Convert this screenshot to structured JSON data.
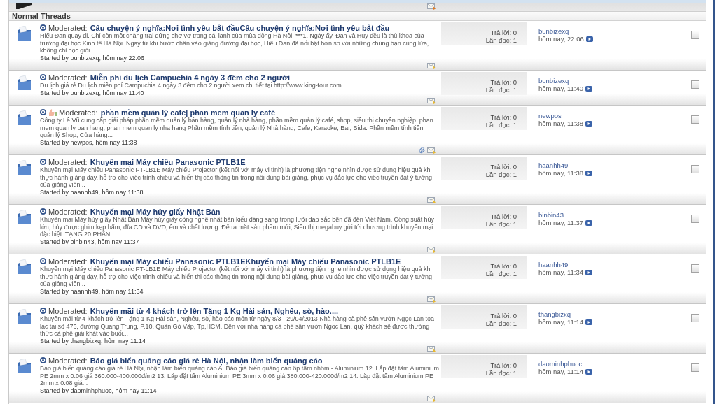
{
  "section": {
    "title": "Normal Threads"
  },
  "threads": [
    {
      "status_label": "Moderated:",
      "post_icon": false,
      "title": "Câu chuyện ý nghĩa:Nơi tình yêu bắt đầuCâu chuyện ý nghĩa:Nơi tình yêu bắt đầu",
      "snippet": "Hiếu Đan quay đi. Chỉ còn một chàng trai đứng chơ vơ trong cái lạnh của mùa đông Hà Nội. ***1. Ngày ấy, Đan và Huy đều là thủ khoa của trường đại học Kinh tế Hà Nội. Ngay từ khi bước chân vào giảng đường đại học, Hiếu Đan đã nổi bật hơn so với những chúng bạn cùng lứa, không chỉ học giỏi....",
      "started_by": "Started by bunbizexq, hôm nay 22:06",
      "attachment": false,
      "replies": "Trả lời: 0",
      "views": "Lần đọc: 1",
      "last_poster": "bunbizexq",
      "last_post_time": "hôm nay, 22:06",
      "checked": false
    },
    {
      "status_label": "Moderated:",
      "post_icon": false,
      "title": "Miễn phí du lịch Campuchia 4 ngày 3 đêm cho 2 người",
      "snippet": "Du lịch giá rẻ Du lịch miễn phí Campuchia 4 ngày 3 đêm cho 2 người xem chi tiết tại http://www.king-tour.com",
      "started_by": "Started by bunbizexq, hôm nay 11:40",
      "attachment": false,
      "replies": "Trả lời: 0",
      "views": "Lần đọc: 1",
      "last_poster": "bunbizexq",
      "last_post_time": "hôm nay, 11:40",
      "checked": false
    },
    {
      "status_label": "Moderated:",
      "post_icon": true,
      "title": "phần mềm quản lý cafe| phan mem quan ly café",
      "snippet": "Công ty Lê Vũ cung cấp giải pháp phần mềm quản lý bán hàng, quản lý nhà hàng, phần mềm quản lý café, shop, siêu thị chuyên nghiệp. phan mem quan ly ban hang, phan mem quan ly nha hang Phần mềm tính tiền, quản lý Nhà hàng, Cafe, Karaoke, Bar, Bida. Phần mềm tính tiền, quản lý Shop, Cửa hàng...",
      "started_by": "Started by newpos, hôm nay 11:38",
      "attachment": true,
      "replies": "Trả lời: 0",
      "views": "Lần đọc: 1",
      "last_poster": "newpos",
      "last_post_time": "hôm nay, 11:38",
      "checked": false
    },
    {
      "status_label": "Moderated:",
      "post_icon": false,
      "title": "Khuyến mại Máy chiếu Panasonic PTLB1E",
      "snippet": "Khuyến mại Máy chiếu Panasonic PT-LB1E Máy chiếu Projector (kết nối với máy vi tính) là phương tiện nghe nhìn được sử dụng hiệu quả khi thực hành giảng dạy, hỗ trợ cho việc trình chiếu và hiển thị các thông tin trong nội dung bài giảng, phục vụ đắc lực cho việc truyền đạt ý tưởng của giảng viên...",
      "started_by": "Started by haanhh49, hôm nay 11:38",
      "attachment": false,
      "replies": "Trả lời: 0",
      "views": "Lần đọc: 1",
      "last_poster": "haanhh49",
      "last_post_time": "hôm nay, 11:38",
      "checked": false
    },
    {
      "status_label": "Moderated:",
      "post_icon": false,
      "title": "Khuyến mại Máy hủy giấy Nhật Bản",
      "snippet": "Khuyến mại Máy hủy giấy Nhật Bản Máy hủy giấy công nghệ nhật bản kiểu dáng sang trọng lưỡi dao sắc bền đã đến Việt Nam. Công suất hủy lớn, hủy được ghim kẹp bấm, đĩa CD và DVD, êm và chất lượng. Để ra mắt sản phẩm mới, Siêu thị megabuy gửi tới chương trình khuyến mại đặc biệt. TẶNG 20 PHẦN...",
      "started_by": "Started by binbin43, hôm nay 11:37",
      "attachment": false,
      "replies": "Trả lời: 0",
      "views": "Lần đọc: 1",
      "last_poster": "binbin43",
      "last_post_time": "hôm nay, 11:37",
      "checked": false
    },
    {
      "status_label": "Moderated:",
      "post_icon": false,
      "title": "Khuyến mại Máy chiếu Panasonic PTLB1EKhuyến mại Máy chiếu Panasonic PTLB1E",
      "snippet": "Khuyến mại Máy chiếu Panasonic PT-LB1E Máy chiếu Projector (kết nối với máy vi tính) là phương tiện nghe nhìn được sử dụng hiệu quả khi thực hành giảng dạy, hỗ trợ cho việc trình chiếu và hiển thị các thông tin trong nội dung bài giảng, phục vụ đắc lực cho việc truyền đạt ý tưởng của giảng viên...",
      "started_by": "Started by haanhh49, hôm nay 11:34",
      "attachment": false,
      "replies": "Trả lời: 0",
      "views": "Lần đọc: 1",
      "last_poster": "haanhh49",
      "last_post_time": "hôm nay, 11:34",
      "checked": false
    },
    {
      "status_label": "Moderated:",
      "post_icon": false,
      "title": "Khuyến mãi từ 4 khách trở lên Tặng 1 Kg Hải sản, Nghêu, sò, hào....",
      "snippet": "Khuyến mãi từ 4 khách trở lên Tặng 1 Kg Hải sản, Nghêu, sò, hào các món từ ngày 8/3 - 29/04/2013 Nhà hàng cà phê sân vườn Ngọc Lan tọa lạc tại số 476, đường Quang Trung, P.10, Quận Gò Vấp, Tp,HCM. Đến với nhà hàng cà phê sân vườn Ngọc Lan, quý khách sẽ được thưởng thức cà phê giải khát vào buổi...",
      "started_by": "Started by thangbizxq, hôm nay 11:14",
      "attachment": false,
      "replies": "Trả lời: 0",
      "views": "Lần đọc: 1",
      "last_poster": "thangbizxq",
      "last_post_time": "hôm nay, 11:14",
      "checked": false
    },
    {
      "status_label": "Moderated:",
      "post_icon": false,
      "title": "Báo giá biển quảng cáo giá rẻ Hà Nội, nhận làm biển quảng cáo",
      "snippet": "Báo giá biển quảng cáo giá rẻ Hà Nội, nhận làm biển quảng cáo A. Báo giá biển quảng cáo ốp tấm nhôm - Aluminium 12. Lắp đặt tấm Aluminium PE 2mm x 0.06 giá 360.000-400.000đ/m2 13. Lắp đặt tấm Aluminium PE 3mm x 0.06 giá 380.000-420.000đ/m2 14. Lắp đặt tấm Aluminium PE 2mm x 0.08 giá...",
      "started_by": "Started by daominhphuoc, hôm nay 11:14",
      "attachment": false,
      "replies": "Trả lời: 0",
      "views": "Lần đọc: 1",
      "last_poster": "daominhphuoc",
      "last_post_time": "hôm nay, 11:14",
      "checked": false
    }
  ]
}
